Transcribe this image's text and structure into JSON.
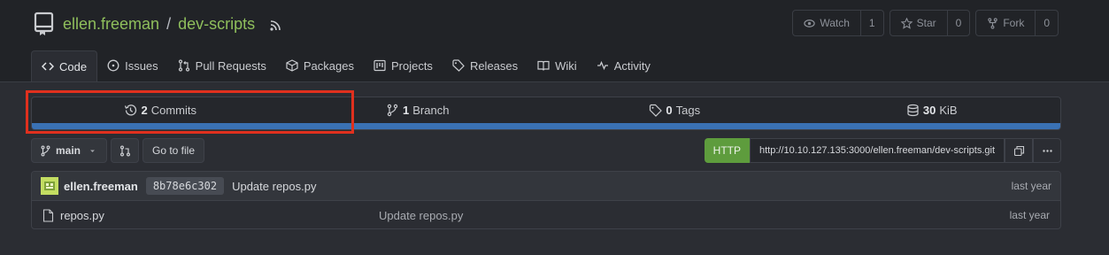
{
  "repo": {
    "owner": "ellen.freeman",
    "separator": "/",
    "name": "dev-scripts"
  },
  "actions": {
    "watch": {
      "label": "Watch",
      "count": "1"
    },
    "star": {
      "label": "Star",
      "count": "0"
    },
    "fork": {
      "label": "Fork",
      "count": "0"
    }
  },
  "tabs": [
    {
      "label": "Code",
      "icon": "code-icon"
    },
    {
      "label": "Issues",
      "icon": "issue-icon"
    },
    {
      "label": "Pull Requests",
      "icon": "pull-request-icon"
    },
    {
      "label": "Packages",
      "icon": "package-icon"
    },
    {
      "label": "Projects",
      "icon": "project-icon"
    },
    {
      "label": "Releases",
      "icon": "tag-icon"
    },
    {
      "label": "Wiki",
      "icon": "book-icon"
    },
    {
      "label": "Activity",
      "icon": "pulse-icon"
    }
  ],
  "stats": {
    "commits": {
      "count": "2",
      "label": "Commits"
    },
    "branches": {
      "count": "1",
      "label": "Branch"
    },
    "tags": {
      "count": "0",
      "label": "Tags"
    },
    "size": {
      "count": "30",
      "label": "KiB"
    }
  },
  "toolbar": {
    "branch": "main",
    "goto_file": "Go to file",
    "clone_protocol": "HTTP",
    "clone_url": "http://10.10.127.135:3000/ellen.freeman/dev-scripts.git"
  },
  "latest_commit": {
    "author": "ellen.freeman",
    "sha": "8b78e6c302",
    "message": "Update repos.py",
    "when": "last year"
  },
  "files": [
    {
      "name": "repos.py",
      "message": "Update repos.py",
      "when": "last year"
    }
  ],
  "colors": {
    "accent": "#8fbf5c",
    "language_bar": "#3a71b4",
    "highlight": "#e0301e"
  }
}
